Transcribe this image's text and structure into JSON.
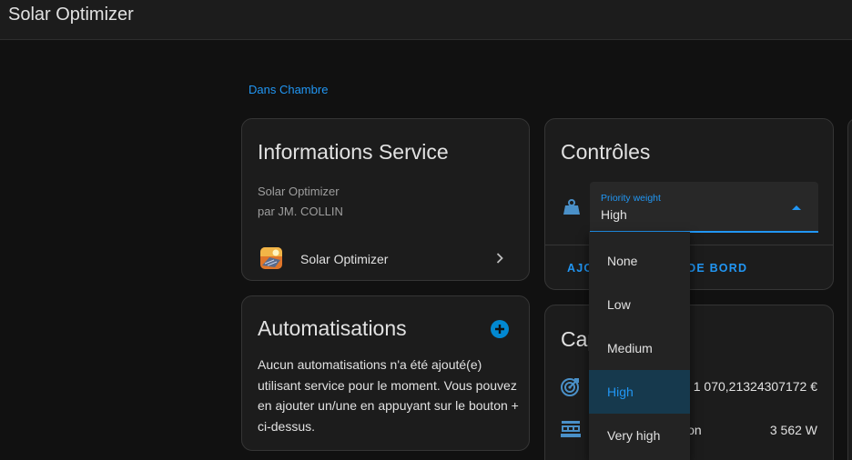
{
  "app": {
    "title": "Solar Optimizer"
  },
  "breadcrumb": {
    "label": "Dans Chambre"
  },
  "info_card": {
    "title": "Informations Service",
    "line1": "Solar Optimizer",
    "line2": "par JM. COLLIN",
    "service_link": {
      "label": "Solar Optimizer",
      "icon": "solar-optimizer-logo"
    }
  },
  "automations_card": {
    "title": "Automatisations",
    "empty_text": "Aucun automatisations n'a été ajouté(e) utilisant service pour le moment. Vous pouvez en ajouter un/une en appuyant sur le bouton + ci-dessus.",
    "add_icon": "plus-circle-icon"
  },
  "controls_card": {
    "title": "Contrôles",
    "select": {
      "label": "Priority weight",
      "value": "High",
      "icon": "weight-icon",
      "options": [
        "None",
        "Low",
        "Medium",
        "High",
        "Very high"
      ],
      "selected_index": 3
    },
    "action_left": "AJO",
    "action_right": "AU DE BORD"
  },
  "sensors_card": {
    "title": "Cap",
    "rows": [
      {
        "icon": "target-icon",
        "name": "",
        "value": "1 070,21324307172 €"
      },
      {
        "icon": "solar-panel-icon",
        "name": "ion",
        "value": "3 562 W"
      }
    ]
  },
  "colors": {
    "accent": "#2196f3",
    "background": "#111111",
    "card": "#1c1c1c",
    "selected_bg": "#16394d"
  }
}
